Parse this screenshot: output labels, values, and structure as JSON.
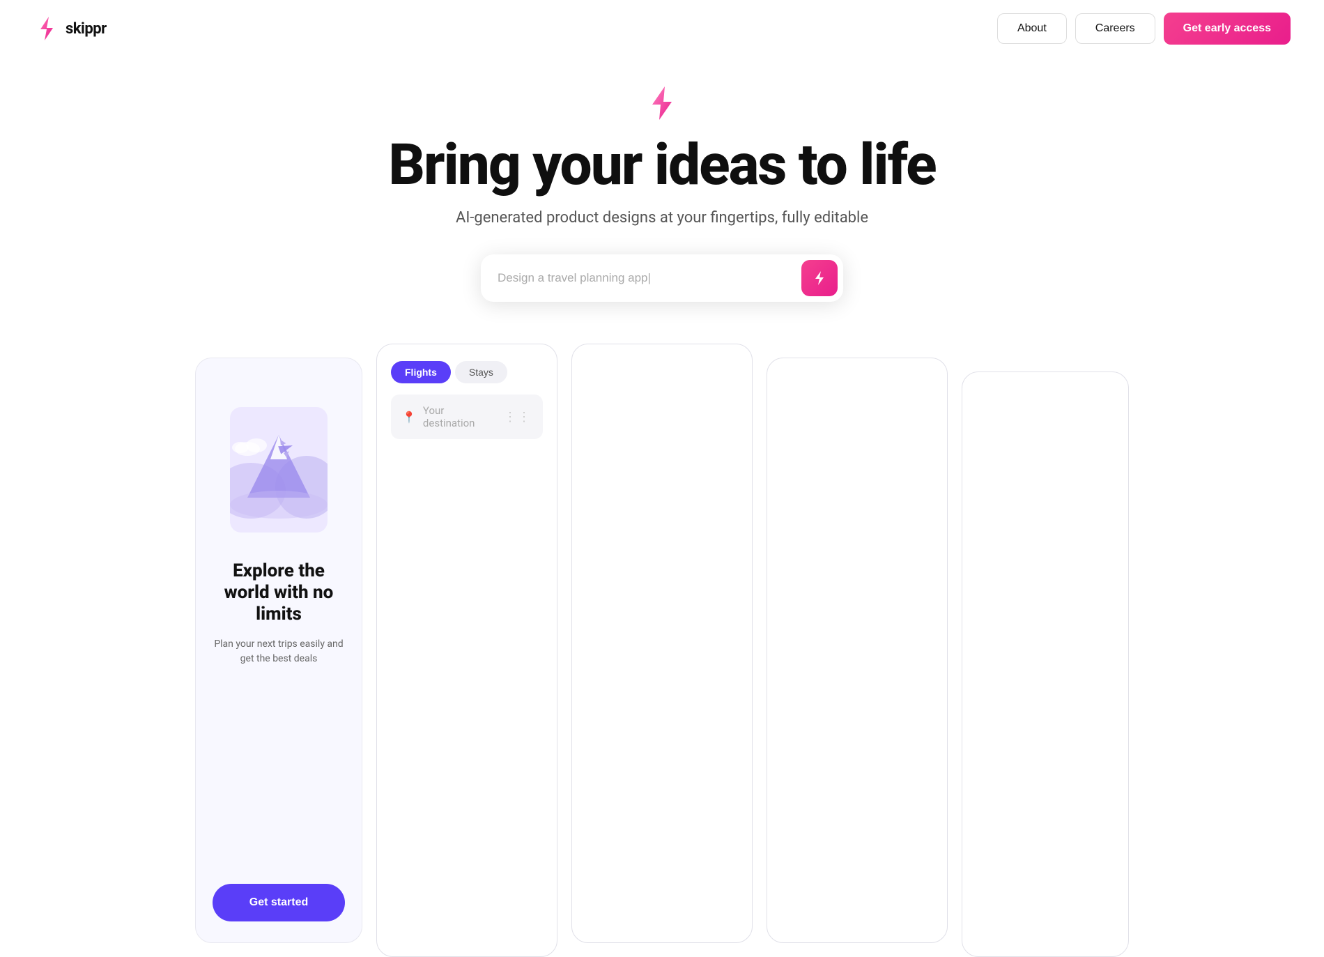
{
  "nav": {
    "logo_text": "skippr",
    "about_label": "About",
    "careers_label": "Careers",
    "cta_label": "Get early access"
  },
  "hero": {
    "title": "Bring your ideas to life",
    "subtitle": "AI-generated product designs at your fingertips, fully editable",
    "search_placeholder": "Design a travel planning app|"
  },
  "card1": {
    "title": "Explore the world with no limits",
    "description": "Plan your next trips easily and get the best deals",
    "cta_label": "Get started"
  },
  "card2": {
    "tab_flights": "Flights",
    "tab_stays": "Stays",
    "destination_placeholder": "Your destination"
  },
  "colors": {
    "brand_pink": "#f43f8e",
    "brand_purple": "#5a3ef8",
    "accent_gradient_start": "#f43f8e",
    "accent_gradient_end": "#e91e8c"
  }
}
